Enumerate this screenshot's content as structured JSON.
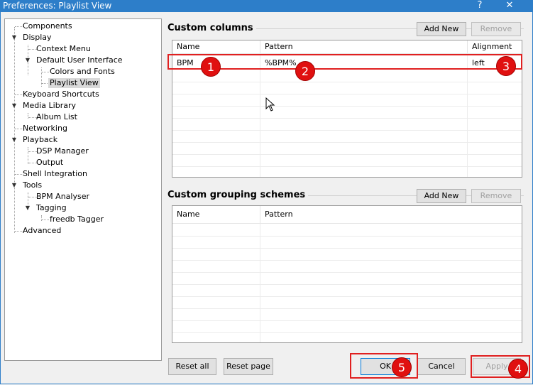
{
  "window": {
    "title": "Preferences: Playlist View",
    "help": "?",
    "close": "✕"
  },
  "tree": [
    {
      "label": "Components"
    },
    {
      "label": "Display"
    },
    {
      "label": "Context Menu"
    },
    {
      "label": "Default User Interface"
    },
    {
      "label": "Colors and Fonts"
    },
    {
      "label": "Playlist View"
    },
    {
      "label": "Keyboard Shortcuts"
    },
    {
      "label": "Media Library"
    },
    {
      "label": "Album List"
    },
    {
      "label": "Networking"
    },
    {
      "label": "Playback"
    },
    {
      "label": "DSP Manager"
    },
    {
      "label": "Output"
    },
    {
      "label": "Shell Integration"
    },
    {
      "label": "Tools"
    },
    {
      "label": "BPM Analyser"
    },
    {
      "label": "Tagging"
    },
    {
      "label": "freedb Tagger"
    },
    {
      "label": "Advanced"
    }
  ],
  "custom_columns": {
    "title": "Custom columns",
    "add_new": "Add New",
    "remove": "Remove",
    "headers": [
      "Name",
      "Pattern",
      "Alignment"
    ],
    "rows": [
      {
        "name": "BPM",
        "pattern": "%BPM%",
        "alignment": "left"
      }
    ]
  },
  "grouping": {
    "title": "Custom grouping schemes",
    "add_new": "Add New",
    "remove": "Remove",
    "headers": [
      "Name",
      "Pattern"
    ]
  },
  "footer": {
    "reset_all": "Reset all",
    "reset_page": "Reset page",
    "ok": "OK",
    "cancel": "Cancel",
    "apply": "Apply"
  },
  "badges": [
    "1",
    "2",
    "3",
    "4",
    "5"
  ],
  "colors": {
    "titlebar": "#2d7ec9",
    "annotation": "#e01010"
  }
}
